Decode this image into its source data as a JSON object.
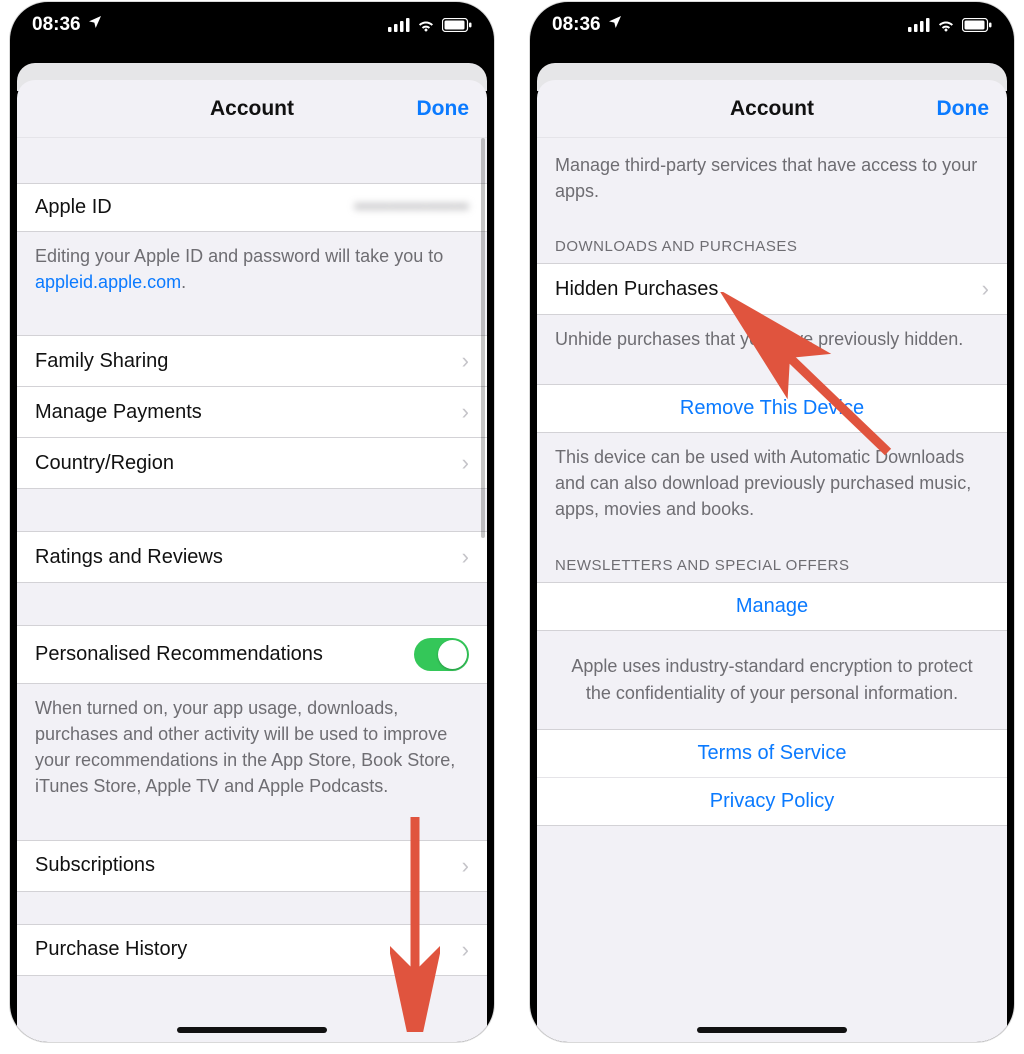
{
  "status": {
    "time": "08:36"
  },
  "navbar": {
    "title": "Account",
    "done": "Done"
  },
  "left": {
    "apple_id_label": "Apple ID",
    "apple_id_value": "••••••••••••••••",
    "apple_id_footnote_pre": "Editing your Apple ID and password will take you to ",
    "apple_id_footnote_link": "appleid.apple.com",
    "apple_id_footnote_post": ".",
    "family_sharing": "Family Sharing",
    "manage_payments": "Manage Payments",
    "country_region": "Country/Region",
    "ratings_reviews": "Ratings and Reviews",
    "personalised": "Personalised Recommendations",
    "personalised_footnote": "When turned on, your app usage, downloads, purchases and other activity will be used to improve your recommendations in the App Store, Book Store, iTunes Store, Apple TV and Apple Podcasts.",
    "subscriptions": "Subscriptions",
    "purchase_history": "Purchase History"
  },
  "right": {
    "top_footnote": "Manage third-party services that have access to your apps.",
    "downloads_header": "Downloads and Purchases",
    "hidden_purchases": "Hidden Purchases",
    "hidden_footnote": "Unhide purchases that you have previously hidden.",
    "remove_device": "Remove This Device",
    "remove_footnote": "This device can be used with Automatic Downloads and can also download previously purchased music, apps, movies and books.",
    "newsletters_header": "Newsletters and Special Offers",
    "manage": "Manage",
    "encryption_note": "Apple uses industry-standard encryption to protect the confidentiality of your personal information.",
    "terms": "Terms of Service",
    "privacy": "Privacy Policy"
  }
}
